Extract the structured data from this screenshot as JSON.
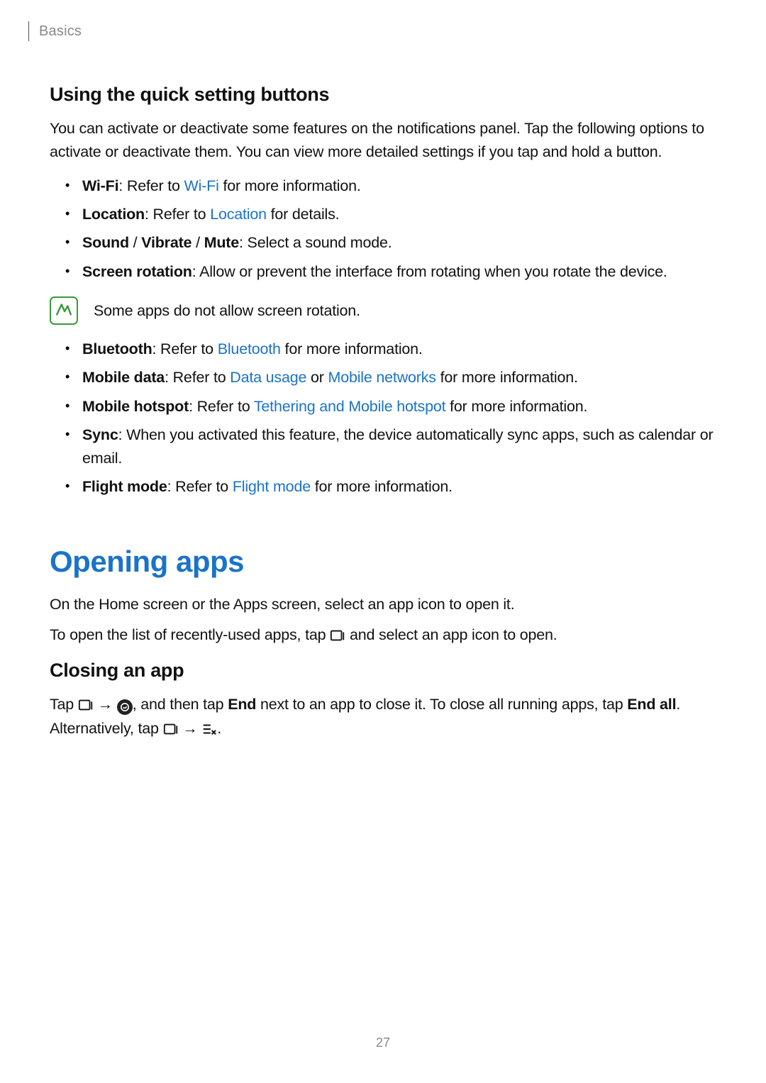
{
  "breadcrumb": "Basics",
  "section1": {
    "heading": "Using the quick setting buttons",
    "intro": "You can activate or deactivate some features on the notifications panel. Tap the following options to activate or deactivate them. You can view more detailed settings if you tap and hold a button.",
    "items_a": {
      "wifi_b": "Wi-Fi",
      "wifi_t1": ": Refer to ",
      "wifi_link": "Wi-Fi",
      "wifi_t2": " for more information.",
      "loc_b": "Location",
      "loc_t1": ": Refer to ",
      "loc_link": "Location",
      "loc_t2": " for details.",
      "sound_b": "Sound",
      "sound_sep1": " / ",
      "vibrate_b": "Vibrate",
      "sound_sep2": " / ",
      "mute_b": "Mute",
      "sound_t": ": Select a sound mode.",
      "rot_b": "Screen rotation",
      "rot_t": ": Allow or prevent the interface from rotating when you rotate the device."
    },
    "note": "Some apps do not allow screen rotation.",
    "items_b": {
      "bt_b": "Bluetooth",
      "bt_t1": ": Refer to ",
      "bt_link": "Bluetooth",
      "bt_t2": " for more information.",
      "md_b": "Mobile data",
      "md_t1": ": Refer to ",
      "md_link1": "Data usage",
      "md_or": " or ",
      "md_link2": "Mobile networks",
      "md_t2": " for more information.",
      "mh_b": "Mobile hotspot",
      "mh_t1": ": Refer to ",
      "mh_link": "Tethering and Mobile hotspot",
      "mh_t2": " for more information.",
      "sync_b": "Sync",
      "sync_t": ": When you activated this feature, the device automatically sync apps, such as calendar or email.",
      "fm_b": "Flight mode",
      "fm_t1": ": Refer to ",
      "fm_link": "Flight mode",
      "fm_t2": " for more information."
    }
  },
  "section2": {
    "title": "Opening apps",
    "p1": "On the Home screen or the Apps screen, select an app icon to open it.",
    "p2_a": "To open the list of recently-used apps, tap ",
    "p2_b": " and select an app icon to open.",
    "closing_heading": "Closing an app",
    "close_a": "Tap ",
    "arrow": " → ",
    "close_b": ", and then tap ",
    "end": "End",
    "close_c": " next to an app to close it. To close all running apps, tap ",
    "endall": "End all",
    "close_d": ". Alternatively, tap ",
    "close_e": "."
  },
  "page_number": "27"
}
